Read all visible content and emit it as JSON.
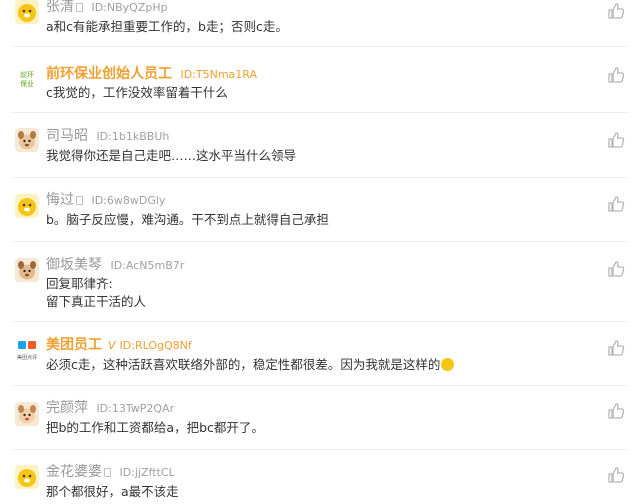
{
  "comments": [
    {
      "nickname": "张清",
      "uid": "ID:NByQZpHp",
      "text": "a和c有能承担重要工作的，b走；否则c走。"
    },
    {
      "nickname": "前环保业创始人员工",
      "uid": "ID:T5Nma1RA",
      "text": "c我觉的，工作没效率留着干什么",
      "avatar_text": "前环\n保业"
    },
    {
      "nickname": "司马昭",
      "uid": "ID:1b1kBBUh",
      "text": "我觉得你还是自己走吧……这水平当什么领导"
    },
    {
      "nickname": "悔过",
      "uid": "ID:6w8wDGly",
      "text": "b。脑子反应慢，难沟通。干不到点上就得自己承担"
    },
    {
      "nickname": "御坂美琴",
      "uid": "ID:AcN5mB7r",
      "text_line1": "回复耶律齐:",
      "text_line2": "留下真正干活的人"
    },
    {
      "nickname": "美团员工",
      "badge": "V",
      "uid": "ID:RLOgQ8Nf",
      "text": "必须c走，这种活跃喜欢联络外部的，稳定性都很差。因为我就是这样的",
      "avatar_text": "美团点评"
    },
    {
      "nickname": "完颜萍",
      "uid": "ID:13TwP2QAr",
      "text": "把b的工作和工资都给a，把bc都开了。"
    },
    {
      "nickname": "金花婆婆",
      "uid": "ID:jjZfttCL",
      "text": "那个都很好，a最不该走"
    }
  ]
}
